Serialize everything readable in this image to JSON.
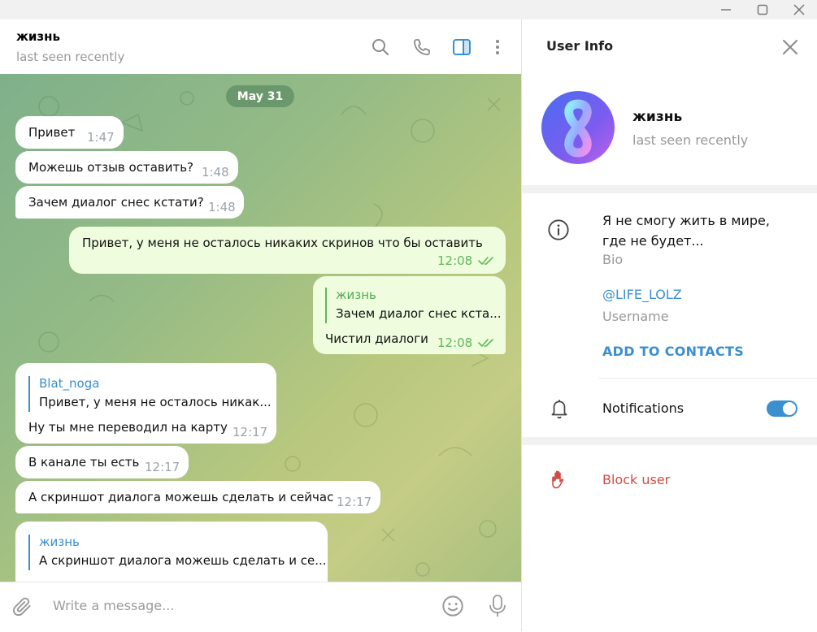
{
  "header": {
    "chat_name": "жизнь",
    "chat_status": "last seen recently"
  },
  "chat": {
    "date_label": "May 31",
    "messages": [
      {
        "direction": "in",
        "text": "Привет",
        "time": "1:47"
      },
      {
        "direction": "in",
        "text": "Можешь отзыв оставить?",
        "time": "1:48"
      },
      {
        "direction": "in",
        "text": "Зачем диалог снес кстати?",
        "time": "1:48"
      },
      {
        "direction": "out",
        "text": "Привет, у меня не осталось никаких скринов что бы оставить",
        "time": "12:08",
        "read": true
      },
      {
        "direction": "out",
        "reply_name": "жизнь",
        "reply_text": "Зачем диалог снес кста...",
        "text": "Чистил диалоги",
        "time": "12:08",
        "read": true
      },
      {
        "direction": "in",
        "reply_name": "Blat_noga",
        "reply_text": "Привет, у меня не осталось никак...",
        "text": "Ну ты мне переводил на карту",
        "time": "12:17"
      },
      {
        "direction": "in",
        "text": "В канале ты есть",
        "time": "12:17"
      },
      {
        "direction": "in",
        "text": "А скриншот диалога можешь сделать и сейчас",
        "time": "12:17"
      },
      {
        "direction": "in",
        "reply_name": "жизнь",
        "reply_text": "А скриншот диалога можешь сделать и се...",
        "text": ""
      }
    ]
  },
  "composer": {
    "placeholder": "Write a message..."
  },
  "panel": {
    "title": "User Info",
    "name": "жизнь",
    "status": "last seen recently",
    "bio": "Я не смогу жить в мире, где не будет...",
    "bio_label": "Bio",
    "username": "@LIFE_LOLZ",
    "username_label": "Username",
    "add_contacts": "ADD TO CONTACTS",
    "notifications_label": "Notifications",
    "notifications_on": true,
    "block_label": "Block user"
  },
  "colors": {
    "accent": "#3a8fcf",
    "outgoing_bubble": "#effdde",
    "danger": "#d24a43"
  }
}
